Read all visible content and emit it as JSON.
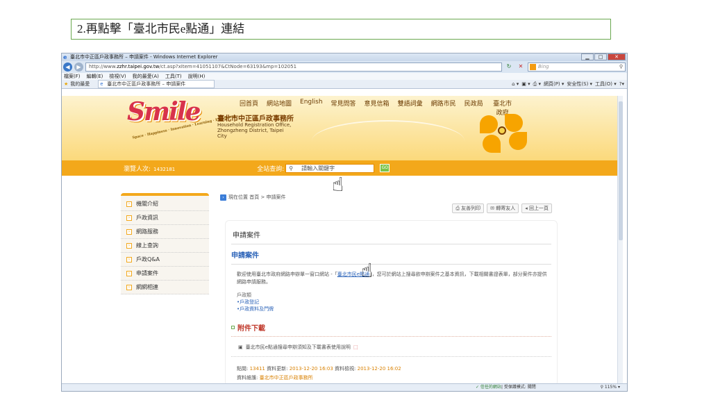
{
  "step_caption": "2.再點擊「臺北市民e點通」連結",
  "browser": {
    "title": "臺北市中正區戶政事務所 – 申請案件 - Windows Internet Explorer",
    "url_prefix": "http://www.",
    "url_domain": "zzhr.taipei.gov.tw",
    "url_rest": "/ct.asp?xItem=41051107&CtNode=63193&mp=102051",
    "search_placeholder": "Bing",
    "menu": [
      "檔案(F)",
      "編輯(E)",
      "檢視(V)",
      "我的最愛(A)",
      "工具(T)",
      "說明(H)"
    ],
    "favorites_label": "我的最愛",
    "tab_title": "臺北市中正區戶政事務所 – 申請案件",
    "cmd": [
      "網頁(P) ▾",
      "安全性(S) ▾",
      "工具(O) ▾",
      "?▾"
    ],
    "status_zone": "✓ 信任的網站",
    "status_mode": "| 受保護模式: 關閉",
    "zoom": "115% ▾"
  },
  "site": {
    "logo_text": "Smile",
    "logo_sub": "Space · Happiness · Innovation · Learning · Excellence",
    "name_zh": "臺北市中正區戶政事務所",
    "name_en": "Household Registration Office, Zhongzheng District, Taipei City",
    "topnav": [
      "回首頁",
      "網站地圖",
      "English",
      "常見問答",
      "意見信箱",
      "雙語詞彙",
      "網路市民",
      "民政局",
      "臺北市政府"
    ],
    "counter_label": "瀏覽人次:",
    "counter_value": "1432181",
    "search_label": "全站查詢:",
    "search_placeholder": "請輸入關鍵字",
    "search_go": "GO"
  },
  "sidebar": {
    "items": [
      {
        "label": "機關介紹"
      },
      {
        "label": "戶政資訊"
      },
      {
        "label": "網路服務"
      },
      {
        "label": "線上查詢"
      },
      {
        "label": "戶政Q&A"
      },
      {
        "label": "申請案件"
      },
      {
        "label": "網網相連"
      }
    ]
  },
  "main": {
    "breadcrumb": "現在位置  首頁 > 申請案件",
    "tools": [
      "友善列印",
      "轉寄友人",
      "回上一頁"
    ],
    "page_title": "申請案件",
    "heading": "申請案件",
    "intro_before": "歡迎使用臺北市政府網路申辦單一窗口網站 -「",
    "intro_link": "臺北市民e點通",
    "intro_after": "」，您可於網站上搜尋欲申辦案件之基本資訊，下載相關書證表單，部分案件亦提供網路申請服務。",
    "category": "戶政類",
    "links": [
      "•戶政登記",
      "•戶政資料及門牌"
    ],
    "attachments_title": "附件下載",
    "attachment_item": "臺北市民e點通搜尋申辦須知及下載書表使用說明",
    "meta_clicks_label": "點閱:",
    "meta_clicks": "13411",
    "meta_updated_label": "資料更新:",
    "meta_updated": "2013-12-20 16:03",
    "meta_checked_label": "資料檢視:",
    "meta_checked": "2013-12-20 16:02",
    "meta_source_label": "資料維護:",
    "meta_source": "臺北市中正區戶政事務所"
  }
}
